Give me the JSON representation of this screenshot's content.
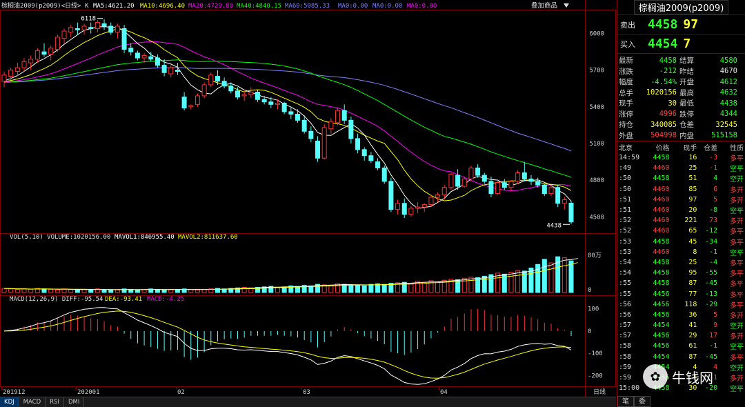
{
  "chart_header": {
    "symbol": "棕榈油2009(p2009)<日线>",
    "k_label": "K",
    "ma5": "MA5:4621.20",
    "ma10": "MA10:4696.40",
    "ma20": "MA20:4729.80",
    "ma40": "MA40:4840.15",
    "ma60": "MA60:5085.33",
    "ma0a": "MA0:0.00",
    "ma0b": "MA0:0.00",
    "ma0c": "MA0:0.00",
    "overlay_label": "叠加商品",
    "overlay_icon": "dropdown-triangle-icon"
  },
  "vol_header": {
    "label": "VOL(5,10) VOLUME:1020156.00",
    "mavol1": "MAVOL1:846955.40",
    "mavol2": "MAVOL2:811637.60"
  },
  "macd_header": {
    "label": "MACD(12,26,9) DIFF:-95.54",
    "dea": "DEA:-93.41",
    "macd": "MACD:-4.25"
  },
  "annotations": {
    "high": "6118",
    "low": "4438"
  },
  "price_axis": [
    "6000",
    "5700",
    "5400",
    "5100",
    "4800",
    "4500"
  ],
  "vol_axis": [
    "80万",
    "0"
  ],
  "macd_axis": [
    "100",
    "0",
    "-100",
    "-200"
  ],
  "date_axis": [
    "201912",
    "202001",
    "02",
    "03",
    "04",
    "日线"
  ],
  "bottom_tabs": [
    "KDJ",
    "MACD",
    "RSI",
    "DMI"
  ],
  "panel": {
    "title": "棕榈油2009(p2009)",
    "sell_label": "卖出",
    "sell_price": "4458",
    "sell_qty": "97",
    "buy_label": "买入",
    "buy_price": "4454",
    "buy_qty": "7",
    "stats": [
      {
        "k1": "最新",
        "v1": "4458",
        "c1": "green",
        "k2": "结算",
        "v2": "4580",
        "c2": "green"
      },
      {
        "k1": "涨跌",
        "v1": "-212",
        "c1": "green",
        "k2": "昨结",
        "v2": "4670",
        "c2": "white"
      },
      {
        "k1": "幅度",
        "v1": "-4.54%",
        "c1": "green",
        "k2": "开盘",
        "v2": "4612",
        "c2": "green"
      },
      {
        "k1": "总手",
        "v1": "1020156",
        "c1": "yellow",
        "k2": "最高",
        "v2": "4632",
        "c2": "green"
      },
      {
        "k1": "现手",
        "v1": "30",
        "c1": "yellow",
        "k2": "最低",
        "v2": "4438",
        "c2": "green"
      },
      {
        "k1": "涨停",
        "v1": "4996",
        "c1": "red",
        "k2": "跌停",
        "v2": "4344",
        "c2": "green"
      },
      {
        "k1": "持仓",
        "v1": "340085",
        "c1": "yellow",
        "k2": "仓差",
        "v2": "32545",
        "c2": "yellow"
      },
      {
        "k1": "外盘",
        "v1": "504998",
        "c1": "red",
        "k2": "内盘",
        "v2": "515158",
        "c2": "green"
      }
    ],
    "ticks_head": {
      "time": "北京",
      "price": "价格",
      "qty": "现手",
      "oi": "仓差",
      "nature": "性质"
    },
    "ticks": [
      {
        "time": "14:59",
        "price": "4458",
        "pc": "green",
        "qty": "16",
        "oi": "-3",
        "oc": "red",
        "nature": "多平",
        "nc": "red"
      },
      {
        "time": ":49",
        "price": "4460",
        "pc": "red",
        "qty": "25",
        "oi": "-1",
        "oc": "red",
        "nature": "空平",
        "nc": "green"
      },
      {
        "time": ":50",
        "price": "4458",
        "pc": "green",
        "qty": "51",
        "oi": "4",
        "oc": "green",
        "nature": "空开",
        "nc": "green"
      },
      {
        "time": ":50",
        "price": "4460",
        "pc": "red",
        "qty": "85",
        "oi": "6",
        "oc": "red",
        "nature": "多开",
        "nc": "red"
      },
      {
        "time": ":51",
        "price": "4460",
        "pc": "red",
        "qty": "97",
        "oi": "5",
        "oc": "red",
        "nature": "多开",
        "nc": "red"
      },
      {
        "time": ":51",
        "price": "4460",
        "pc": "red",
        "qty": "20",
        "oi": "-8",
        "oc": "green",
        "nature": "空平",
        "nc": "green"
      },
      {
        "time": ":52",
        "price": "4460",
        "pc": "red",
        "qty": "221",
        "oi": "73",
        "oc": "red",
        "nature": "多开",
        "nc": "red"
      },
      {
        "time": ":52",
        "price": "4460",
        "pc": "red",
        "qty": "65",
        "oi": "-12",
        "oc": "green",
        "nature": "多平",
        "nc": "red"
      },
      {
        "time": ":53",
        "price": "4458",
        "pc": "green",
        "qty": "45",
        "oi": "-34",
        "oc": "green",
        "nature": "多平",
        "nc": "red"
      },
      {
        "time": ":53",
        "price": "4460",
        "pc": "red",
        "qty": "8",
        "oi": "-1",
        "oc": "green",
        "nature": "空平",
        "nc": "green"
      },
      {
        "time": ":54",
        "price": "4458",
        "pc": "green",
        "qty": "25",
        "oi": "-4",
        "oc": "green",
        "nature": "多平",
        "nc": "red"
      },
      {
        "time": ":54",
        "price": "4458",
        "pc": "green",
        "qty": "95",
        "oi": "-55",
        "oc": "green",
        "nature": "多平",
        "nc": "red"
      },
      {
        "time": ":55",
        "price": "4458",
        "pc": "green",
        "qty": "87",
        "oi": "-45",
        "oc": "green",
        "nature": "多平",
        "nc": "red"
      },
      {
        "time": ":55",
        "price": "4456",
        "pc": "green",
        "qty": "77",
        "oi": "-13",
        "oc": "green",
        "nature": "多平",
        "nc": "red"
      },
      {
        "time": ":56",
        "price": "4456",
        "pc": "green",
        "qty": "118",
        "oi": "-29",
        "oc": "green",
        "nature": "多平",
        "nc": "red"
      },
      {
        "time": ":56",
        "price": "4456",
        "pc": "green",
        "qty": "36",
        "oi": "5",
        "oc": "red",
        "nature": "多开",
        "nc": "red"
      },
      {
        "time": ":57",
        "price": "4454",
        "pc": "green",
        "qty": "41",
        "oi": "9",
        "oc": "red",
        "nature": "空开",
        "nc": "green"
      },
      {
        "time": ":57",
        "price": "4456",
        "pc": "green",
        "qty": "29",
        "oi": "17",
        "oc": "red",
        "nature": "多开",
        "nc": "red"
      },
      {
        "time": ":58",
        "price": "4456",
        "pc": "green",
        "qty": "61",
        "oi": "-1",
        "oc": "green",
        "nature": "空平",
        "nc": "green"
      },
      {
        "time": ":58",
        "price": "4454",
        "pc": "green",
        "qty": "87",
        "oi": "-45",
        "oc": "green",
        "nature": "多平",
        "nc": "red"
      },
      {
        "time": ":59",
        "price": "4454",
        "pc": "green",
        "qty": "4",
        "oi": "4",
        "oc": "red",
        "nature": "空开",
        "nc": "green"
      },
      {
        "time": ":59",
        "price": "4456",
        "pc": "green",
        "qty": "1",
        "oi": "1",
        "oc": "red",
        "nature": "多开",
        "nc": "red"
      },
      {
        "time": "15:00",
        "price": "4458",
        "pc": "green",
        "qty": "30",
        "oi": "-20",
        "oc": "green",
        "nature": "空平",
        "nc": "green"
      }
    ],
    "panel_tabs": [
      "笔",
      "委"
    ]
  },
  "watermark": {
    "text": "牛钱网"
  },
  "colors": {
    "up": "#ff3232",
    "down": "#54ffff",
    "ma5": "#ffffff",
    "ma10": "#ffff00",
    "ma20": "#ff00ff",
    "ma40": "#00ff00",
    "ma60": "#8080ff",
    "frame": "#800000"
  },
  "chart_data": {
    "type": "candlestick",
    "ohlc": [
      [
        5610,
        5690,
        5560,
        5660
      ],
      [
        5650,
        5720,
        5620,
        5700
      ],
      [
        5690,
        5760,
        5650,
        5720
      ],
      [
        5720,
        5800,
        5690,
        5770
      ],
      [
        5760,
        5820,
        5700,
        5790
      ],
      [
        5790,
        5880,
        5760,
        5860
      ],
      [
        5850,
        5920,
        5810,
        5830
      ],
      [
        5830,
        5900,
        5780,
        5880
      ],
      [
        5870,
        5990,
        5850,
        5970
      ],
      [
        5960,
        6040,
        5920,
        6020
      ],
      [
        6010,
        6070,
        5970,
        6050
      ],
      [
        6040,
        6090,
        5990,
        6030
      ],
      [
        6030,
        6080,
        5990,
        6060
      ],
      [
        6050,
        6090,
        6000,
        6040
      ],
      [
        6040,
        6110,
        6010,
        6090
      ],
      [
        6080,
        6118,
        6030,
        6060
      ],
      [
        6060,
        6090,
        5990,
        6010
      ],
      [
        6010,
        6080,
        5960,
        6060
      ],
      [
        6040,
        6070,
        5840,
        5870
      ],
      [
        5880,
        5920,
        5820,
        5850
      ],
      [
        5840,
        5860,
        5780,
        5800
      ],
      [
        5800,
        5840,
        5760,
        5820
      ],
      [
        5810,
        5850,
        5770,
        5790
      ],
      [
        5800,
        5830,
        5720,
        5740
      ],
      [
        5740,
        5790,
        5650,
        5680
      ],
      [
        5670,
        5740,
        5640,
        5720
      ],
      [
        5700,
        5760,
        5660,
        5690
      ],
      [
        5480,
        5520,
        5370,
        5390
      ],
      [
        5400,
        5420,
        5380,
        5410
      ],
      [
        5420,
        5510,
        5400,
        5490
      ],
      [
        5490,
        5600,
        5470,
        5580
      ],
      [
        5580,
        5680,
        5560,
        5660
      ],
      [
        5650,
        5700,
        5580,
        5610
      ],
      [
        5610,
        5640,
        5550,
        5570
      ],
      [
        5570,
        5600,
        5510,
        5530
      ],
      [
        5530,
        5560,
        5460,
        5480
      ],
      [
        5490,
        5530,
        5450,
        5500
      ],
      [
        5500,
        5560,
        5470,
        5520
      ],
      [
        5520,
        5540,
        5440,
        5460
      ],
      [
        5460,
        5490,
        5420,
        5440
      ],
      [
        5440,
        5480,
        5390,
        5420
      ],
      [
        5420,
        5460,
        5380,
        5430
      ],
      [
        5430,
        5440,
        5340,
        5360
      ],
      [
        5360,
        5400,
        5300,
        5340
      ],
      [
        5340,
        5380,
        5270,
        5290
      ],
      [
        5290,
        5330,
        5180,
        5200
      ],
      [
        5200,
        5240,
        5110,
        5140
      ],
      [
        5120,
        5160,
        4950,
        4980
      ],
      [
        4980,
        5260,
        4970,
        5230
      ],
      [
        5220,
        5310,
        5180,
        5280
      ],
      [
        5270,
        5390,
        5250,
        5370
      ],
      [
        5370,
        5420,
        5260,
        5290
      ],
      [
        5290,
        5320,
        5100,
        5140
      ],
      [
        5140,
        5180,
        5020,
        5050
      ],
      [
        5050,
        5070,
        4960,
        5000
      ],
      [
        5000,
        5030,
        4940,
        4960
      ],
      [
        4950,
        4980,
        4880,
        4900
      ],
      [
        4900,
        4920,
        4770,
        4790
      ],
      [
        4790,
        4820,
        4540,
        4560
      ],
      [
        4560,
        4640,
        4520,
        4610
      ],
      [
        4610,
        4650,
        4490,
        4520
      ],
      [
        4520,
        4590,
        4500,
        4570
      ],
      [
        4570,
        4620,
        4530,
        4580
      ],
      [
        4580,
        4610,
        4540,
        4600
      ],
      [
        4600,
        4680,
        4580,
        4660
      ],
      [
        4660,
        4700,
        4620,
        4680
      ],
      [
        4680,
        4760,
        4640,
        4740
      ],
      [
        4740,
        4860,
        4720,
        4850
      ],
      [
        4840,
        4890,
        4720,
        4750
      ],
      [
        4750,
        4830,
        4740,
        4810
      ],
      [
        4810,
        4920,
        4790,
        4900
      ],
      [
        4900,
        4930,
        4820,
        4840
      ],
      [
        4840,
        4860,
        4770,
        4790
      ],
      [
        4790,
        4830,
        4660,
        4690
      ],
      [
        4690,
        4790,
        4680,
        4780
      ],
      [
        4780,
        4810,
        4720,
        4740
      ],
      [
        4740,
        4800,
        4710,
        4790
      ],
      [
        4790,
        4880,
        4770,
        4860
      ],
      [
        4860,
        4950,
        4790,
        4810
      ],
      [
        4810,
        4840,
        4760,
        4790
      ],
      [
        4790,
        4820,
        4740,
        4760
      ],
      [
        4760,
        4770,
        4670,
        4690
      ],
      [
        4690,
        4760,
        4670,
        4740
      ],
      [
        4740,
        4760,
        4580,
        4610
      ],
      [
        4610,
        4660,
        4560,
        4640
      ],
      [
        4612,
        4632,
        4438,
        4458
      ]
    ],
    "volume_relative": [
      0.08,
      0.07,
      0.06,
      0.07,
      0.06,
      0.08,
      0.07,
      0.06,
      0.05,
      0.07,
      0.06,
      0.05,
      0.06,
      0.05,
      0.07,
      0.06,
      0.05,
      0.05,
      0.07,
      0.06,
      0.05,
      0.06,
      0.07,
      0.06,
      0.05,
      0.06,
      0.06,
      0.07,
      0.06,
      0.05,
      0.06,
      0.07,
      0.08,
      0.07,
      0.08,
      0.09,
      0.1,
      0.09,
      0.1,
      0.11,
      0.12,
      0.1,
      0.11,
      0.13,
      0.12,
      0.14,
      0.13,
      0.16,
      0.15,
      0.14,
      0.17,
      0.16,
      0.15,
      0.14,
      0.13,
      0.16,
      0.17,
      0.16,
      0.18,
      0.19,
      0.2,
      0.18,
      0.22,
      0.2,
      0.23,
      0.21,
      0.24,
      0.26,
      0.25,
      0.28,
      0.3,
      0.29,
      0.32,
      0.35,
      0.38,
      0.36,
      0.4,
      0.43,
      0.42,
      0.48,
      0.55,
      0.65,
      0.58,
      0.7,
      0.68,
      0.62,
      0.75
    ],
    "price_ylim": [
      4400,
      6150
    ],
    "macd_ylim": [
      -230,
      130
    ]
  }
}
